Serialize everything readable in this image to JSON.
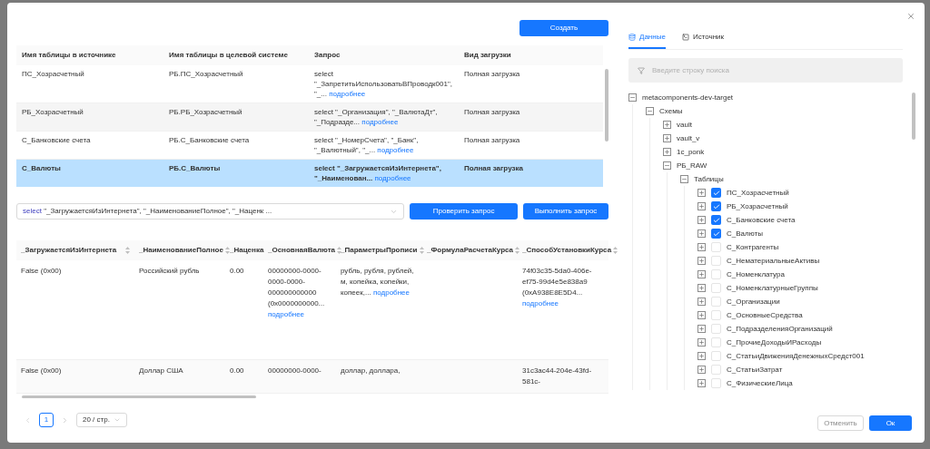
{
  "create_button": "Создать",
  "source_table": {
    "columns": [
      "Имя таблицы в источнике",
      "Имя таблицы в целевой системе",
      "Запрос",
      "Вид загрузки"
    ],
    "rows": [
      {
        "selected": false,
        "cells": [
          "ПС_Хозрасчетный",
          "РБ.ПС_Хозрасчетный",
          "select \"_ЗапретитьИспользоватьВПроводк001\", \"_...",
          "Полная загрузка"
        ],
        "more": "подробнее"
      },
      {
        "selected": false,
        "cells": [
          "РБ_Хозрасчетный",
          "РБ.РБ_Хозрасчетный",
          "select \"_Организация\", \"_ВалютаДт\", \"_Подразде...",
          "Полная загрузка"
        ],
        "more": "подробнее"
      },
      {
        "selected": false,
        "cells": [
          "С_Банковские счета",
          "РБ.С_Банковские счета",
          "select \"_НомерСчета\", \"_Банк\", \"_Валютный\", \"_...",
          "Полная загрузка"
        ],
        "more": "подробнее"
      },
      {
        "selected": true,
        "cells": [
          "С_Валюты",
          "РБ.С_Валюты",
          "select \"_ЗагружаетсяИзИнтернета\", \"_Наименован...",
          "Полная загрузка"
        ],
        "more": "подробнее"
      }
    ]
  },
  "query_field": {
    "keyword": "select",
    "text": "\"_ЗагружаетсяИзИнтернета\", \"_НаименованиеПолное\", \"_Наценк ..."
  },
  "check_button": "Проверить запрос",
  "run_button": "Выполнить запрос",
  "result_table": {
    "columns": [
      "_ЗагружаетсяИзИнтернета",
      "_НаименованиеПолное",
      "_Наценка",
      "_ОсновнаяВалюта",
      "_ПараметрыПрописи",
      "_ФормулаРасчетаКурса",
      "_СпособУстановкиКурса"
    ],
    "rows": [
      {
        "cells": [
          {
            "text": "False (0x00)"
          },
          {
            "text": "Российский рубль"
          },
          {
            "text": "0.00"
          },
          {
            "text": "00000000-0000-0000-0000-000000000000 (0x0000000000...",
            "more": "подробнее"
          },
          {
            "text": "рубль, рубля, рублей, м, копейка, копейки, копеек,...",
            "more": "подробнее"
          },
          {},
          {
            "text": "74f03c35-5da0-406e-ef75-99d4e5e838a9 (0xA938E8E5D4...",
            "more": "подробнее"
          }
        ]
      },
      {
        "cells": [
          {
            "text": "False (0x00)"
          },
          {
            "text": "Доллар США"
          },
          {
            "text": "0.00"
          },
          {
            "text": "00000000-0000-"
          },
          {
            "text": "доллар, доллара,"
          },
          {},
          {
            "text": "31c3ac44-204e-43fd-581c-"
          }
        ]
      }
    ]
  },
  "pagination": {
    "pages": [
      {
        "label": "1",
        "selected": true
      }
    ],
    "page_size": "20 / стр."
  },
  "tabs": [
    {
      "label": "Данные",
      "selected": true
    },
    {
      "label": "Источник",
      "selected": false
    }
  ],
  "search": {
    "placeholder": "Введите строку поиска"
  },
  "tree": [
    {
      "label": "metacomponents-dev-target",
      "expanded": true,
      "children": [
        {
          "label": "Схемы",
          "expanded": true,
          "children": [
            {
              "label": "vault",
              "expanded": false
            },
            {
              "label": "vault_v",
              "expanded": false
            },
            {
              "label": "1c_ponk",
              "expanded": false
            },
            {
              "label": "РБ_RAW",
              "expanded": true,
              "children": [
                {
                  "label": "Таблицы",
                  "expanded": true,
                  "children": [
                    {
                      "label": "ПС_Хозрасчетный",
                      "expanded": false,
                      "checked": true
                    },
                    {
                      "label": "РБ_Хозрасчетный",
                      "expanded": false,
                      "checked": true
                    },
                    {
                      "label": "С_Банковские счета",
                      "expanded": false,
                      "checked": true
                    },
                    {
                      "label": "С_Валюты",
                      "expanded": false,
                      "checked": true
                    },
                    {
                      "label": "С_Контрагенты",
                      "expanded": false,
                      "checked": false
                    },
                    {
                      "label": "С_НематериальныеАктивы",
                      "expanded": false,
                      "checked": false
                    },
                    {
                      "label": "С_Номенклатура",
                      "expanded": false,
                      "checked": false
                    },
                    {
                      "label": "С_НоменклатурныеГруппы",
                      "expanded": false,
                      "checked": false
                    },
                    {
                      "label": "С_Организации",
                      "expanded": false,
                      "checked": false
                    },
                    {
                      "label": "С_ОсновныеСредства",
                      "expanded": false,
                      "checked": false
                    },
                    {
                      "label": "С_ПодразделенияОрганизаций",
                      "expanded": false,
                      "checked": false
                    },
                    {
                      "label": "С_ПрочиеДоходыИРасходы",
                      "expanded": false,
                      "checked": false
                    },
                    {
                      "label": "С_СтатьиДвиженияДенежныхСредст001",
                      "expanded": false,
                      "checked": false
                    },
                    {
                      "label": "С_СтатьиЗатрат",
                      "expanded": false,
                      "checked": false
                    },
                    {
                      "label": "С_ФизическиеЛица",
                      "expanded": false,
                      "checked": false
                    }
                  ]
                }
              ]
            }
          ]
        }
      ]
    }
  ],
  "cancel_button": "Отменить",
  "ok_button": "Ок"
}
